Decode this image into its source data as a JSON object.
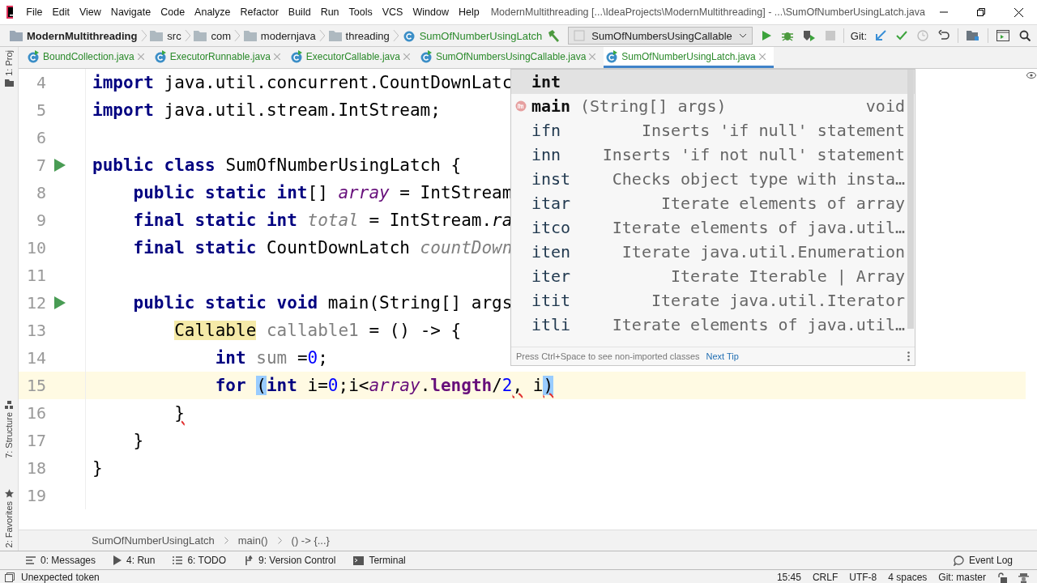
{
  "window": {
    "title": "ModernMultithreading [...\\IdeaProjects\\ModernMultithreading] - ...\\SumOfNumberUsingLatch.java",
    "menu": [
      "File",
      "Edit",
      "View",
      "Navigate",
      "Code",
      "Analyze",
      "Refactor",
      "Build",
      "Run",
      "Tools",
      "VCS",
      "Window",
      "Help"
    ]
  },
  "navbar": {
    "breadcrumbs": [
      {
        "kind": "project",
        "label": "ModernMultithreading"
      },
      {
        "kind": "folder",
        "label": "src"
      },
      {
        "kind": "folder",
        "label": "com"
      },
      {
        "kind": "folder",
        "label": "modernjava"
      },
      {
        "kind": "folder",
        "label": "threading"
      },
      {
        "kind": "class",
        "label": "SumOfNumberUsingLatch"
      }
    ],
    "run_config": "SumOfNumbersUsingCallable",
    "git_label": "Git:"
  },
  "side_strip": [
    {
      "kind": "project",
      "label": "1: Proj"
    },
    {
      "kind": "structure",
      "label": "7: Structure"
    },
    {
      "kind": "favorites",
      "label": "2: Favorites"
    }
  ],
  "tabs": [
    {
      "label": "BoundCollection.java",
      "selected": false
    },
    {
      "label": "ExecutorRunnable.java",
      "selected": false
    },
    {
      "label": "ExecutorCallable.java",
      "selected": false
    },
    {
      "label": "SumOfNumbersUsingCallable.java",
      "selected": false
    },
    {
      "label": "SumOfNumberUsingLatch.java",
      "selected": true
    }
  ],
  "editor": {
    "lines": [
      {
        "number": "4",
        "run_marker": false,
        "current": false,
        "tokens": [
          {
            "kind": "keyword",
            "text": "import"
          },
          {
            "kind": "plain",
            "text": " java.util.concurrent.CountDownLatc"
          }
        ]
      },
      {
        "number": "5",
        "run_marker": false,
        "current": false,
        "tokens": [
          {
            "kind": "keyword",
            "text": "import"
          },
          {
            "kind": "plain",
            "text": " java.util.stream.IntStream;"
          }
        ]
      },
      {
        "number": "6",
        "run_marker": false,
        "current": false
      },
      {
        "number": "7",
        "run_marker": true,
        "current": false,
        "tokens": [
          {
            "kind": "keyword",
            "text": "public class"
          },
          {
            "kind": "plain",
            "text": " SumOfNumberUsingLatch {"
          }
        ]
      },
      {
        "number": "8",
        "run_marker": false,
        "current": false,
        "tokens": [
          {
            "kind": "keyword",
            "text": "    public static int"
          },
          {
            "kind": "plain",
            "text": "[] "
          },
          {
            "kind": "static",
            "text": "array"
          },
          {
            "kind": "plain",
            "text": " = IntStream"
          }
        ]
      },
      {
        "number": "9",
        "run_marker": false,
        "current": false,
        "tokens": [
          {
            "kind": "keyword",
            "text": "    final static int "
          },
          {
            "kind": "unused-static",
            "text": "total"
          },
          {
            "kind": "plain",
            "text": " = IntStream."
          },
          {
            "kind": "static-call",
            "text": "ra"
          }
        ]
      },
      {
        "number": "10",
        "run_marker": false,
        "current": false,
        "tokens": [
          {
            "kind": "keyword",
            "text": "    final static"
          },
          {
            "kind": "plain",
            "text": " CountDownLatch "
          },
          {
            "kind": "unused-static",
            "text": "countDown"
          }
        ]
      },
      {
        "number": "11",
        "run_marker": false,
        "current": false
      },
      {
        "number": "12",
        "run_marker": true,
        "current": false,
        "tokens": [
          {
            "kind": "keyword",
            "text": "    public static void"
          },
          {
            "kind": "plain",
            "text": " main(String[] args"
          }
        ]
      },
      {
        "number": "13",
        "run_marker": false,
        "current": false,
        "tokens": [
          {
            "kind": "usage",
            "text": "        Callable"
          },
          {
            "kind": "unused",
            "text": " callable1"
          },
          {
            "kind": "plain",
            "text": " = () -> {"
          }
        ]
      },
      {
        "number": "14",
        "run_marker": false,
        "current": false,
        "tokens": [
          {
            "kind": "keyword",
            "text": "            int "
          },
          {
            "kind": "unused",
            "text": "sum"
          },
          {
            "kind": "plain",
            "text": " ="
          },
          {
            "kind": "number",
            "text": "0"
          },
          {
            "kind": "plain",
            "text": ";"
          }
        ]
      },
      {
        "number": "15",
        "run_marker": false,
        "current": true,
        "tokens": [
          {
            "kind": "keyword",
            "text": "            for "
          },
          {
            "kind": "brace",
            "text": "("
          },
          {
            "kind": "keyword",
            "text": "int"
          },
          {
            "kind": "plain",
            "text": " i="
          },
          {
            "kind": "number",
            "text": "0"
          },
          {
            "kind": "plain",
            "text": ";i<"
          },
          {
            "kind": "static",
            "text": "array"
          },
          {
            "kind": "plain",
            "text": "."
          },
          {
            "kind": "field",
            "text": "length"
          },
          {
            "kind": "plain",
            "text": "/"
          },
          {
            "kind": "number",
            "text": "2"
          },
          {
            "kind": "error",
            "text": ","
          },
          {
            "kind": "plain",
            "text": " i"
          },
          {
            "kind": "error-brace",
            "text": ")"
          }
        ]
      },
      {
        "number": "16",
        "run_marker": false,
        "current": false,
        "tokens": [
          {
            "kind": "error",
            "text": "        }"
          }
        ]
      },
      {
        "number": "17",
        "run_marker": false,
        "current": false,
        "tokens": [
          {
            "kind": "plain",
            "text": "    }"
          }
        ]
      },
      {
        "number": "18",
        "run_marker": false,
        "current": false,
        "tokens": [
          {
            "kind": "plain",
            "text": "}"
          }
        ]
      },
      {
        "number": "19",
        "run_marker": false,
        "current": false
      }
    ]
  },
  "completion": {
    "items": [
      {
        "kind": "keyword",
        "name": "int",
        "selected": true
      },
      {
        "kind": "method",
        "name": "main",
        "params": "(String[] args)",
        "detail": "void",
        "selected": false
      },
      {
        "kind": "template",
        "name": "ifn",
        "detail": "Inserts 'if null' statement",
        "selected": false
      },
      {
        "kind": "template",
        "name": "inn",
        "detail": "Inserts 'if not null' statement",
        "selected": false
      },
      {
        "kind": "template",
        "name": "inst",
        "detail": "Checks object type with insta…",
        "selected": false
      },
      {
        "kind": "template",
        "name": "itar",
        "detail": "Iterate elements of array",
        "selected": false
      },
      {
        "kind": "template",
        "name": "itco",
        "detail": "Iterate elements of java.util…",
        "selected": false
      },
      {
        "kind": "template",
        "name": "iten",
        "detail": "Iterate java.util.Enumeration",
        "selected": false
      },
      {
        "kind": "template",
        "name": "iter",
        "detail": "Iterate Iterable | Array",
        "selected": false
      },
      {
        "kind": "template",
        "name": "itit",
        "detail": "Iterate java.util.Iterator",
        "selected": false
      },
      {
        "kind": "template",
        "name": "itli",
        "detail": "Iterate elements of java.util…",
        "selected": false
      }
    ],
    "hint": "Press Ctrl+Space to see non-imported classes",
    "tip_link": "Next Tip"
  },
  "breadcrumb": [
    "SumOfNumberUsingLatch",
    "main()",
    "() -> {...}"
  ],
  "tool_windows": [
    {
      "kind": "messages",
      "label": "0: Messages"
    },
    {
      "kind": "run",
      "label": "4: Run"
    },
    {
      "kind": "todo",
      "label": "6: TODO"
    },
    {
      "kind": "vcs",
      "label": "9: Version Control"
    },
    {
      "kind": "terminal",
      "label": "Terminal"
    }
  ],
  "event_log": "Event Log",
  "status_bar": {
    "message": "Unexpected token",
    "items": [
      "15:45",
      "CRLF",
      "UTF-8",
      "4 spaces",
      "Git: master"
    ]
  }
}
